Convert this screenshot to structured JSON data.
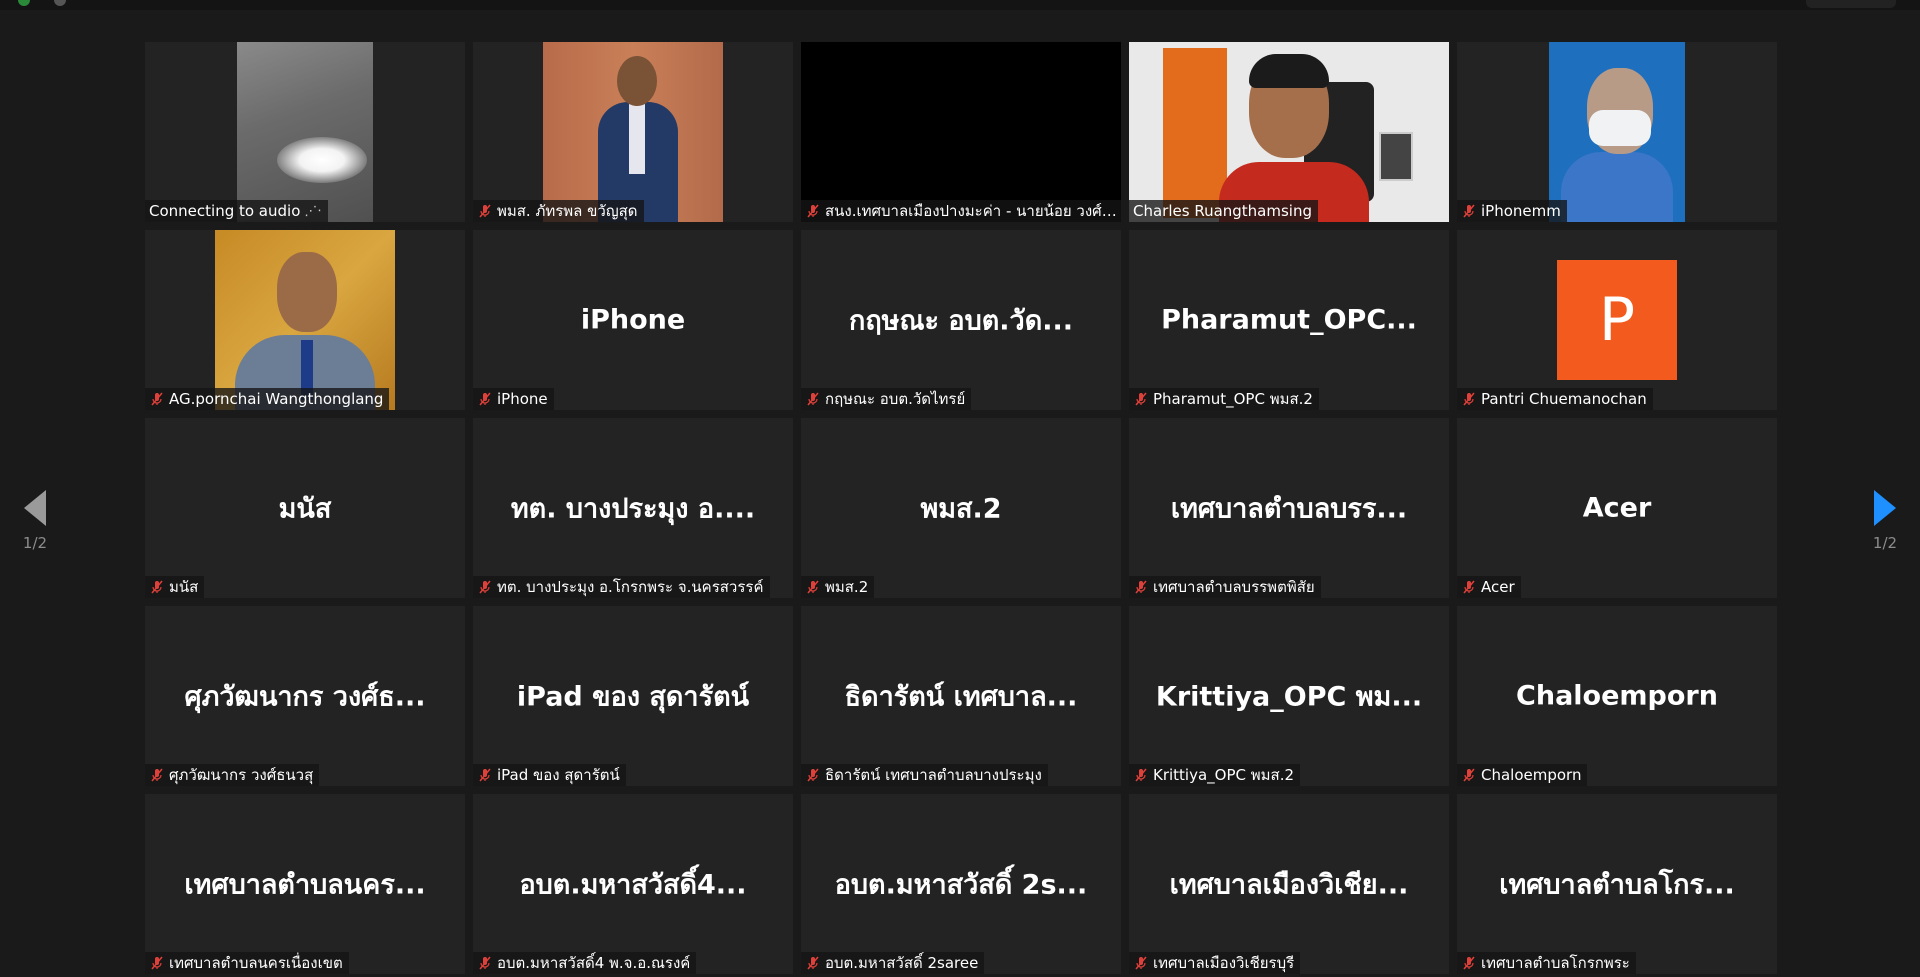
{
  "colors": {
    "background": "#1a1a1a",
    "tile": "#232323",
    "active_speaker_border": "#d7ee84",
    "muted_icon": "#e0403a",
    "next_arrow": "#1e90ff",
    "avatar_p": "#f25a1e"
  },
  "pager": {
    "left_label": "1/2",
    "right_label": "1/2"
  },
  "tiles": [
    {
      "big": "",
      "name": "Connecting to audio",
      "muted": false
    },
    {
      "big": "",
      "name": "พมส. ภัทรพล ขวัญสุด",
      "muted": true
    },
    {
      "big": "",
      "name": "สนง.เทศบาลเมืองปางมะค่า - นายน้อย วงศ์วิทยา...",
      "muted": true
    },
    {
      "big": "",
      "name": "Charles Ruangthamsing",
      "muted": false
    },
    {
      "big": "",
      "name": "iPhonemm",
      "muted": true
    },
    {
      "big": "",
      "name": "AG.pornchai  Wangthonglang",
      "muted": true
    },
    {
      "big": "iPhone",
      "name": "iPhone",
      "muted": true
    },
    {
      "big": "กฤษณะ  อบต.วัด...",
      "name": "กฤษณะ  อบต.วัดไทรย์",
      "muted": true
    },
    {
      "big": "Pharamut_OPC...",
      "name": "Pharamut_OPC พมส.2",
      "muted": true
    },
    {
      "big": "",
      "avatar": "P",
      "name": "Pantri Chuemanochan",
      "muted": true
    },
    {
      "big": "มนัส",
      "name": "มนัส",
      "muted": true
    },
    {
      "big": "ทต. บางประมุง อ....",
      "name": "ทต. บางประมุง อ.โกรกพระ จ.นครสวรรค์",
      "muted": true
    },
    {
      "big": "พมส.2",
      "name": "พมส.2",
      "muted": true
    },
    {
      "big": "เทศบาลตำบลบรร...",
      "name": "เทศบาลตำบลบรรพตพิสัย",
      "muted": true
    },
    {
      "big": "Acer",
      "name": "Acer",
      "muted": true
    },
    {
      "big": "ศุภวัฒนากร วงศ์ธ...",
      "name": "ศุภวัฒนากร วงศ์ธนวสุ",
      "muted": true
    },
    {
      "big": "iPad ของ สุดารัตน์",
      "name": "iPad ของ สุดารัตน์",
      "muted": true
    },
    {
      "big": "ธิดารัตน์  เทศบาล...",
      "name": "ธิดารัตน์  เทศบาลตำบลบางประมุง",
      "muted": true
    },
    {
      "big": "Krittiya_OPC พม...",
      "name": "Krittiya_OPC พมส.2",
      "muted": true
    },
    {
      "big": "Chaloemporn",
      "name": "Chaloemporn",
      "muted": true
    },
    {
      "big": "เทศบาลตำบลนคร...",
      "name": "เทศบาลตำบลนครเนื่องเขต",
      "muted": true
    },
    {
      "big": "อบต.มหาสวัสดิ์4...",
      "name": "อบต.มหาสวัสดิ์4 พ.จ.อ.ณรงค์",
      "muted": true
    },
    {
      "big": "อบต.มหาสวัสดิ์ 2s...",
      "name": "อบต.มหาสวัสดิ์ 2saree",
      "muted": true
    },
    {
      "big": "เทศบาลเมืองวิเชีย...",
      "name": "เทศบาลเมืองวิเชียรบุรี",
      "muted": true
    },
    {
      "big": "เทศบาลตำบลโกร...",
      "name": "เทศบาลตำบลโกรกพระ",
      "muted": true
    }
  ]
}
